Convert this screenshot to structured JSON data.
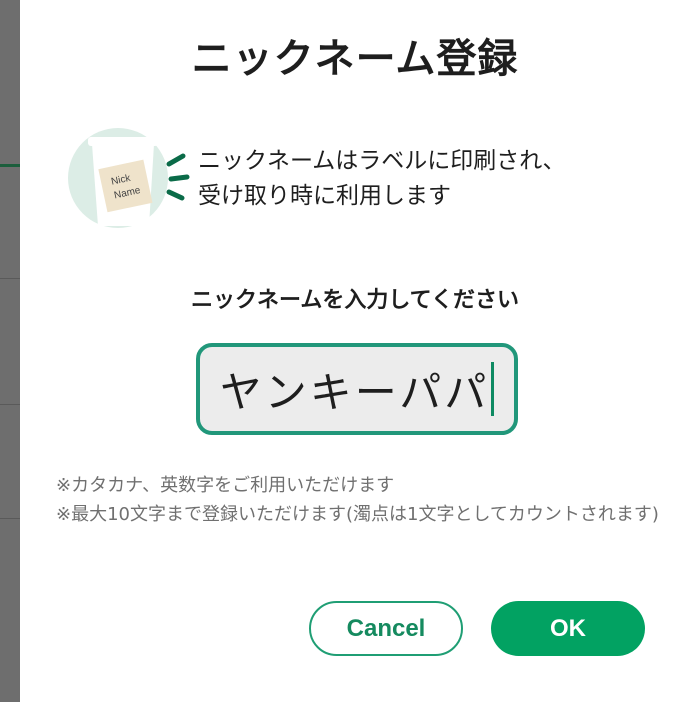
{
  "dialog": {
    "title": "ニックネーム登録",
    "description_line1": "ニックネームはラベルに印刷され、",
    "description_line2": "受け取り時に利用します",
    "illustration_label_line1": "Nick",
    "illustration_label_line2": "Name",
    "prompt": "ニックネームを入力してください",
    "nickname_value": "ヤンキーパパ",
    "note1": "※カタカナ、英数字をご利用いただけます",
    "note2": "※最大10文字まで登録いただけます(濁点は1文字としてカウントされます)",
    "cancel_label": "Cancel",
    "ok_label": "OK"
  },
  "colors": {
    "accent": "#02a262",
    "input_border": "#21977a",
    "note_text": "#707070",
    "backdrop": "#6e6e6e"
  }
}
